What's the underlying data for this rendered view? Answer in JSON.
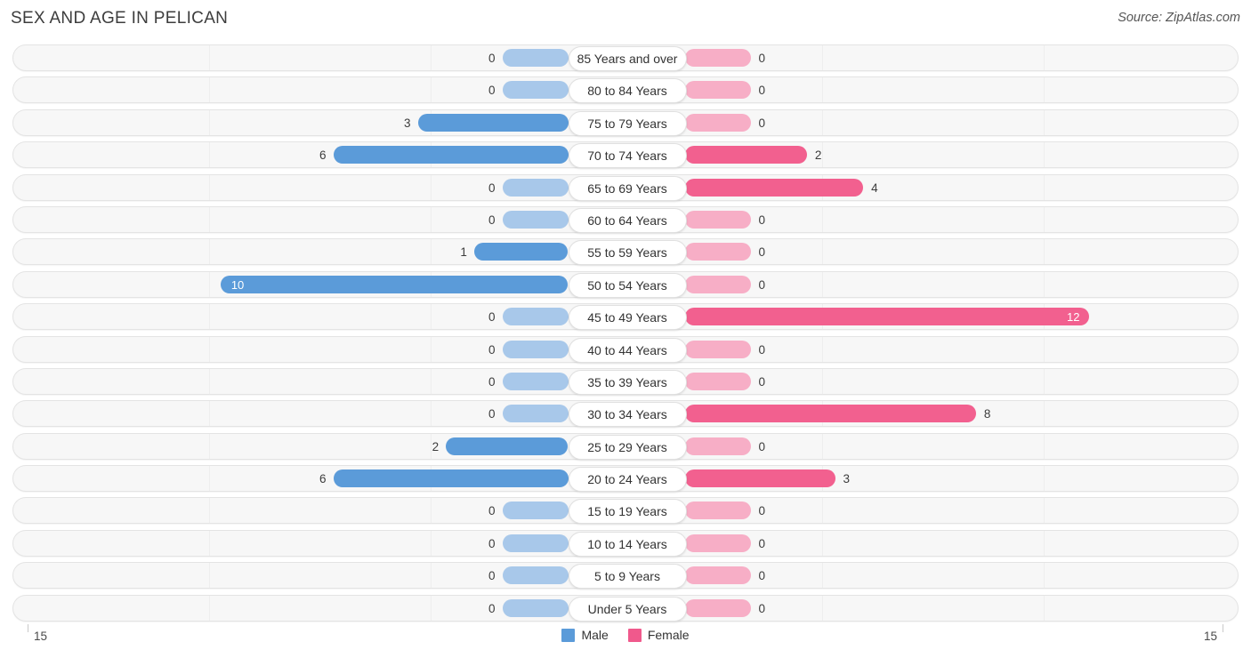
{
  "header": {
    "title": "SEX AND AGE IN PELICAN",
    "source": "Source: ZipAtlas.com"
  },
  "legend": {
    "male_label": "Male",
    "female_label": "Female",
    "male_color": "#5b9bd9",
    "female_color": "#f0598c"
  },
  "axis": {
    "left_tick": "15",
    "right_tick": "15"
  },
  "colors": {
    "male_strong": "#5b9bd9",
    "male_light": "#a8c8ea",
    "female_strong": "#f2608f",
    "female_light": "#f7aec6",
    "row_bg": "#f7f7f7",
    "row_border": "#e4e4e4"
  },
  "chart_data": {
    "type": "bar",
    "title": "SEX AND AGE IN PELICAN",
    "subtitle": "Source: ZipAtlas.com",
    "orientation": "horizontal",
    "style": "population-pyramid",
    "xlabel": "",
    "ylabel": "",
    "xlim": [
      15,
      15
    ],
    "axis_max": 15,
    "grid": false,
    "legend_position": "bottom-center",
    "categories": [
      "85 Years and over",
      "80 to 84 Years",
      "75 to 79 Years",
      "70 to 74 Years",
      "65 to 69 Years",
      "60 to 64 Years",
      "55 to 59 Years",
      "50 to 54 Years",
      "45 to 49 Years",
      "40 to 44 Years",
      "35 to 39 Years",
      "30 to 34 Years",
      "25 to 29 Years",
      "20 to 24 Years",
      "15 to 19 Years",
      "10 to 14 Years",
      "5 to 9 Years",
      "Under 5 Years"
    ],
    "series": [
      {
        "name": "Male",
        "color": "#5b9bd9",
        "values": [
          0,
          0,
          3,
          6,
          0,
          0,
          1,
          10,
          0,
          0,
          0,
          0,
          2,
          6,
          0,
          0,
          0,
          0
        ]
      },
      {
        "name": "Female",
        "color": "#f2608f",
        "values": [
          0,
          0,
          0,
          2,
          4,
          0,
          0,
          0,
          12,
          0,
          0,
          8,
          0,
          3,
          0,
          0,
          0,
          0
        ]
      }
    ]
  },
  "rows": [
    {
      "age": "85 Years and over",
      "male": "0",
      "female": "0"
    },
    {
      "age": "80 to 84 Years",
      "male": "0",
      "female": "0"
    },
    {
      "age": "75 to 79 Years",
      "male": "3",
      "female": "0"
    },
    {
      "age": "70 to 74 Years",
      "male": "6",
      "female": "2"
    },
    {
      "age": "65 to 69 Years",
      "male": "0",
      "female": "4"
    },
    {
      "age": "60 to 64 Years",
      "male": "0",
      "female": "0"
    },
    {
      "age": "55 to 59 Years",
      "male": "1",
      "female": "0"
    },
    {
      "age": "50 to 54 Years",
      "male": "10",
      "female": "0"
    },
    {
      "age": "45 to 49 Years",
      "male": "0",
      "female": "12"
    },
    {
      "age": "40 to 44 Years",
      "male": "0",
      "female": "0"
    },
    {
      "age": "35 to 39 Years",
      "male": "0",
      "female": "0"
    },
    {
      "age": "30 to 34 Years",
      "male": "0",
      "female": "8"
    },
    {
      "age": "25 to 29 Years",
      "male": "2",
      "female": "0"
    },
    {
      "age": "20 to 24 Years",
      "male": "6",
      "female": "3"
    },
    {
      "age": "15 to 19 Years",
      "male": "0",
      "female": "0"
    },
    {
      "age": "10 to 14 Years",
      "male": "0",
      "female": "0"
    },
    {
      "age": "5 to 9 Years",
      "male": "0",
      "female": "0"
    },
    {
      "age": "Under 5 Years",
      "male": "0",
      "female": "0"
    }
  ]
}
